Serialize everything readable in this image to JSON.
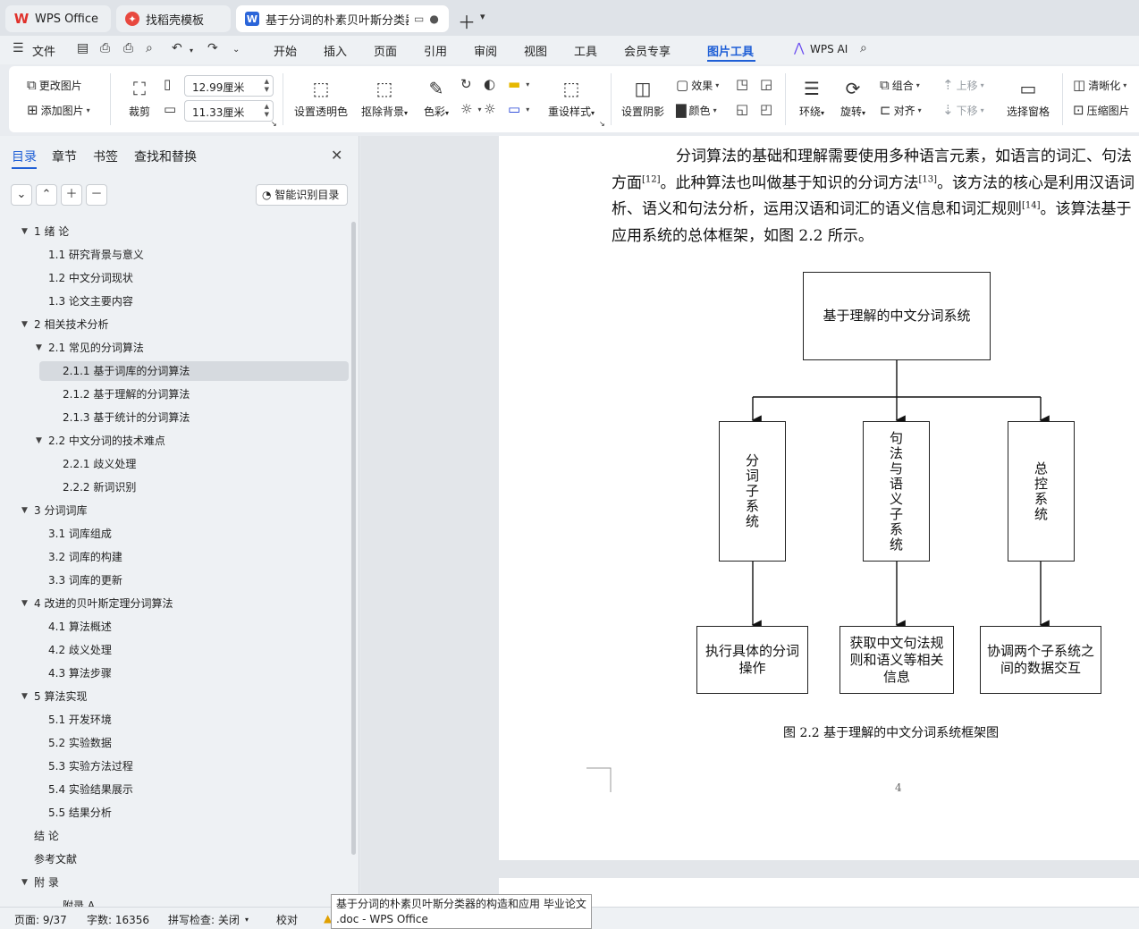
{
  "tabs": [
    {
      "label": "WPS Office"
    },
    {
      "label": "找稻壳模板"
    },
    {
      "label": "基于分词的朴素贝叶斯分类器的构造和应用"
    }
  ],
  "menu": {
    "file": "文件",
    "items": [
      "开始",
      "插入",
      "页面",
      "引用",
      "审阅",
      "视图",
      "工具",
      "会员专享",
      "图片工具"
    ],
    "wps_ai": "WPS AI"
  },
  "ribbon": {
    "change_pic": "更改图片",
    "add_pic": "添加图片",
    "crop": "裁剪",
    "width_value": "12.99厘米",
    "height_value": "11.33厘米",
    "transparent": "设置透明色",
    "remove_bg": "抠除背景",
    "color_mode": "色彩",
    "reset_style": "重设样式",
    "shadow": "设置阴影",
    "effect": "效果",
    "color": "颜色",
    "wrap": "环绕",
    "rotate": "旋转",
    "group": "组合",
    "align": "对齐",
    "move_up": "上移",
    "move_down": "下移",
    "selection_pane": "选择窗格",
    "sharpen": "清晰化",
    "compress": "压缩图片"
  },
  "panel": {
    "tabs": [
      "目录",
      "章节",
      "书签",
      "查找和替换"
    ],
    "smart_toc": "智能识别目录",
    "toc": [
      {
        "text": "1  绪  论",
        "level": 1,
        "expanded": true
      },
      {
        "text": "1.1  研究背景与意义",
        "level": 2
      },
      {
        "text": "1.2  中文分词现状",
        "level": 2
      },
      {
        "text": "1.3  论文主要内容",
        "level": 2
      },
      {
        "text": "2 相关技术分析",
        "level": 1,
        "expanded": true
      },
      {
        "text": "2.1  常见的分词算法",
        "level": 2,
        "expanded": true
      },
      {
        "text": "2.1.1  基于词库的分词算法",
        "level": 3,
        "active": true
      },
      {
        "text": "2.1.2  基于理解的分词算法",
        "level": 3
      },
      {
        "text": "2.1.3  基于统计的分词算法",
        "level": 3
      },
      {
        "text": "2.2  中文分词的技术难点",
        "level": 2,
        "expanded": true
      },
      {
        "text": "2.2.1  歧义处理",
        "level": 3
      },
      {
        "text": "2.2.2  新词识别",
        "level": 3
      },
      {
        "text": "3 分词词库",
        "level": 1,
        "expanded": true
      },
      {
        "text": "3.1  词库组成",
        "level": 2
      },
      {
        "text": "3.2   词库的构建",
        "level": 2
      },
      {
        "text": "3.3   词库的更新",
        "level": 2
      },
      {
        "text": "4   改进的贝叶斯定理分词算法",
        "level": 1,
        "expanded": true
      },
      {
        "text": "4.1   算法概述",
        "level": 2
      },
      {
        "text": "4.2   歧义处理",
        "level": 2
      },
      {
        "text": "4.3   算法步骤",
        "level": 2
      },
      {
        "text": "5   算法实现",
        "level": 1,
        "expanded": true
      },
      {
        "text": "5.1   开发环境",
        "level": 2
      },
      {
        "text": "5.2   实验数据",
        "level": 2
      },
      {
        "text": "5.3   实验方法过程",
        "level": 2
      },
      {
        "text": "5.4   实验结果展示",
        "level": 2
      },
      {
        "text": "5.5  结果分析",
        "level": 2
      },
      {
        "text": "结  论",
        "level": 1
      },
      {
        "text": "参考文献",
        "level": 1
      },
      {
        "text": "附  录",
        "level": 1,
        "expanded": true
      },
      {
        "text": "附录  A",
        "level": 3
      }
    ]
  },
  "document": {
    "line1": "分词算法的基础和理解需要使用多种语言元素，如语言的词汇、句法",
    "line2_a": "方面",
    "line2_ref1": "[12]",
    "line2_b": "。此种算法也叫做基于知识的分词方法",
    "line2_ref2": "[13]",
    "line2_c": "。该方法的核心是利用汉语词",
    "line3_a": "析、语义和句法分析，运用汉语和词汇的语义信息和词汇规则",
    "line3_ref": "[14]",
    "line3_b": "。该算法基于",
    "line4": "应用系统的总体框架，如图 2.2 所示。",
    "diagram": {
      "root": "基于理解的中文分词系统",
      "subsystems": [
        "分词子系统",
        "句法与语义子系统",
        "总控系统"
      ],
      "outputs": [
        "执行具体的分词操作",
        "获取中文句法规则和语义等相关信息",
        "协调两个子系统之间的数据交互"
      ]
    },
    "caption": "图 2.2 基于理解的中文分词系统框架图",
    "page_number": "4"
  },
  "status": {
    "page": "页面: 9/37",
    "words": "字数: 16356",
    "spell": "拼写检查: 关闭",
    "proof": "校对"
  },
  "tooltip": {
    "line1": "基于分词的朴素贝叶斯分类器的构造和应用 毕业论文",
    "line2": ".doc - WPS Office"
  }
}
